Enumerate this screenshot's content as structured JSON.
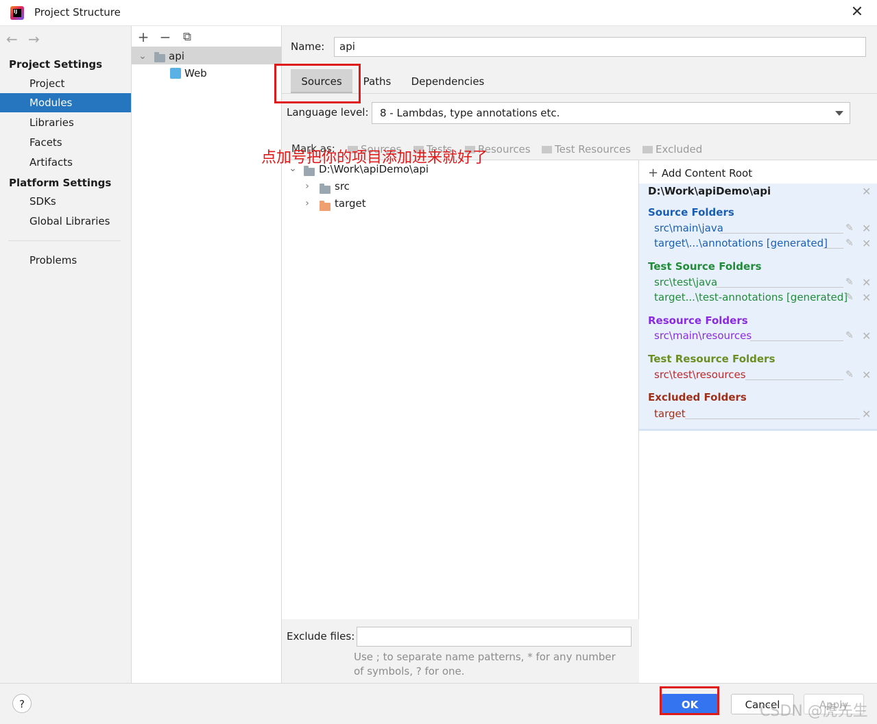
{
  "window": {
    "title": "Project Structure",
    "close_icon": "close-icon"
  },
  "sidebar": {
    "project_settings_heading": "Project Settings",
    "project_items": [
      {
        "label": "Project"
      },
      {
        "label": "Modules",
        "selected": true
      },
      {
        "label": "Libraries"
      },
      {
        "label": "Facets"
      },
      {
        "label": "Artifacts"
      }
    ],
    "platform_settings_heading": "Platform Settings",
    "platform_items": [
      {
        "label": "SDKs"
      },
      {
        "label": "Global Libraries"
      }
    ],
    "problems_label": "Problems"
  },
  "modules": {
    "toolbar": [
      "add-icon",
      "remove-icon",
      "copy-icon"
    ],
    "tree": [
      {
        "label": "api",
        "expanded": true,
        "selected": true
      },
      {
        "label": "Web"
      }
    ]
  },
  "editor": {
    "name_label": "Name:",
    "name_value": "api",
    "tabs": [
      {
        "label": "Sources",
        "selected": true
      },
      {
        "label": "Paths"
      },
      {
        "label": "Dependencies"
      }
    ],
    "language_level_label": "Language level:",
    "language_level_value": "8 - Lambdas, type annotations etc.",
    "mark_as_label": "Mark as:",
    "mark_as_items": [
      "Sources",
      "Tests",
      "Resources",
      "Test Resources",
      "Excluded"
    ],
    "annotation": "点加号把你的项目添加进来就好了",
    "tree": {
      "root": "D:\\Work\\apiDemo\\api",
      "children": [
        {
          "label": "src",
          "color": "grey"
        },
        {
          "label": "target",
          "color": "orange"
        }
      ]
    },
    "exclude_files_label": "Exclude files:",
    "exclude_files_value": "",
    "exclude_hint": "Use ; to separate name patterns, * for any number of symbols, ? for one."
  },
  "content_roots": {
    "add_label": "Add Content Root",
    "root_path": "D:\\Work\\apiDemo\\api",
    "sections": {
      "source": {
        "title": "Source Folders",
        "color": "#1a5fb4",
        "entries": [
          "src\\main\\java",
          "target\\...\\annotations [generated]"
        ]
      },
      "test_source": {
        "title": "Test Source Folders",
        "color": "#228b3a",
        "entries": [
          "src\\test\\java",
          "target...\\test-annotations [generated]"
        ]
      },
      "resource": {
        "title": "Resource Folders",
        "color": "#8a2be2",
        "entries": [
          "src\\main\\resources"
        ]
      },
      "test_resource": {
        "title": "Test Resource Folders",
        "color": "#6b8e23",
        "entries": [
          "src\\test\\resources"
        ]
      },
      "excluded": {
        "title": "Excluded Folders",
        "color": "#a0301a",
        "entries": [
          "target"
        ]
      }
    }
  },
  "footer": {
    "help_label": "?",
    "ok_label": "OK",
    "cancel_label": "Cancel",
    "apply_label": "Apply",
    "watermark": "CSDN @虎先生"
  }
}
